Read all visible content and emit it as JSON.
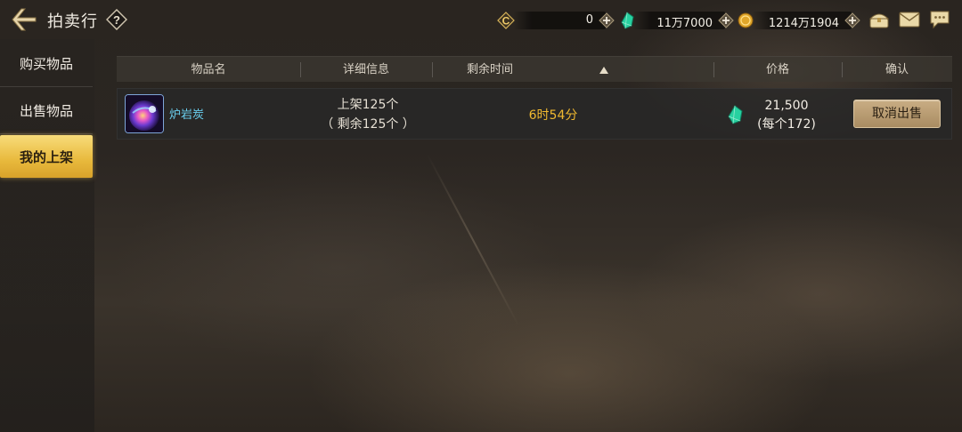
{
  "header": {
    "title": "拍卖行",
    "back_icon": "back-arrow-icon",
    "help_icon": "help-icon"
  },
  "resources": [
    {
      "icon": "c-coin-icon",
      "value": "0"
    },
    {
      "icon": "green-gem-icon",
      "value": "11万7000"
    },
    {
      "icon": "gold-coin-icon",
      "value": "1214万1904"
    }
  ],
  "top_icons": [
    "chest-icon",
    "mail-icon",
    "chat-icon"
  ],
  "sidebar": {
    "items": [
      {
        "label": "购买物品",
        "active": false
      },
      {
        "label": "出售物品",
        "active": false
      },
      {
        "label": "我的上架",
        "active": true
      }
    ]
  },
  "table": {
    "columns": [
      "物品名",
      "详细信息",
      "剩余时间",
      "价格",
      "确认"
    ],
    "sort_icon": "sort-asc-icon",
    "rows": [
      {
        "item_name": "炉岩炭",
        "detail_line1": "上架125个",
        "detail_line2": "（ 剩余125个 ）",
        "time_left": "6时54分",
        "price_total": "21,500",
        "price_each": "(每个172)",
        "action": "取消出售"
      }
    ]
  },
  "colors": {
    "accent_gold": "#e8b93c",
    "time_orange": "#f0b930",
    "item_name_cyan": "#6ad0f0",
    "gem_green": "#27d1a0"
  }
}
